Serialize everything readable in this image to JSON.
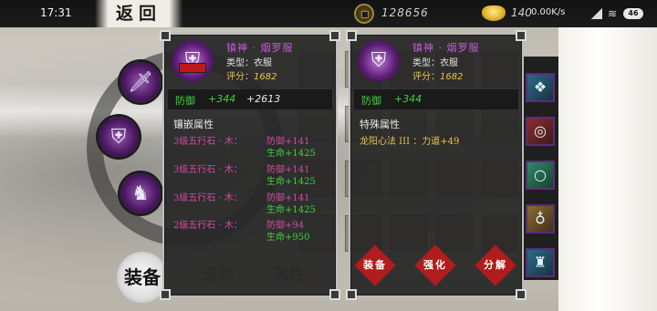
{
  "status_bar": {
    "time": "17:31",
    "net_speed": "0.00K/s",
    "battery": "46"
  },
  "header": {
    "back_label": "返回",
    "coins": "128656",
    "ingots": "140"
  },
  "left_slots": [
    "sword-icon",
    "armor-icon",
    "boots-icon"
  ],
  "bottom_tabs": {
    "equip": "装备",
    "items": "道具",
    "attributes": "属性"
  },
  "panel_left": {
    "name": "镇神 · 烟罗服",
    "type": "类型：衣服",
    "score_label": "评分：",
    "score": "1682",
    "defense_label": "防御",
    "defense_value": "+344",
    "defense_extra": "+2613",
    "section_title": "镶嵌属性",
    "gems": [
      {
        "name": "3级五行石 · 木：",
        "attr1": "防御+141",
        "attr2": "生命+1425"
      },
      {
        "name": "3级五行石 · 木：",
        "attr1": "防御+141",
        "attr2": "生命+1425"
      },
      {
        "name": "3级五行石 · 木：",
        "attr1": "防御+141",
        "attr2": "生命+1425"
      },
      {
        "name": "2级五行石 · 木：",
        "attr1": "防御+94",
        "attr2": "生命+950"
      }
    ]
  },
  "panel_right": {
    "name": "镇神 · 烟罗服",
    "type": "类型：衣服",
    "score_label": "评分：",
    "score": "1682",
    "defense_label": "防御",
    "defense_value": "+344",
    "section_title": "特殊属性",
    "special": "龙阳心法 III ：力道+49"
  },
  "actions": {
    "equip": "装备",
    "forge": "强化",
    "split": "分解"
  },
  "colors": {
    "name_purple": "#c65adb",
    "green_stat": "#3fd13f",
    "gold_score": "#e8c34a",
    "gem_pink": "#d34aa0",
    "action_red": "#b11c1c"
  }
}
